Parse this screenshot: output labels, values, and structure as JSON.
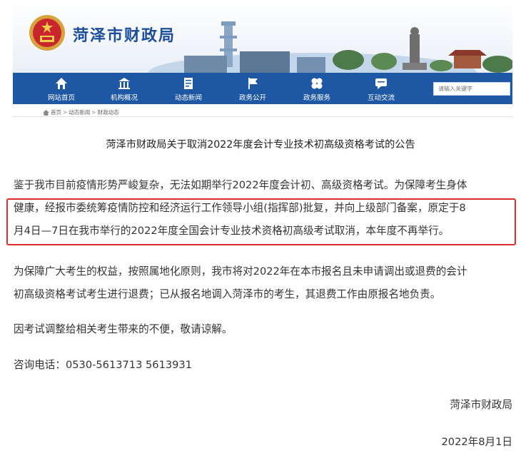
{
  "header": {
    "site_name": "菏泽市财政局",
    "search": {
      "placeholder": "请输入关键字"
    }
  },
  "nav": {
    "items": [
      {
        "label": "网站首页",
        "icon": "home-icon"
      },
      {
        "label": "机构概况",
        "icon": "building-icon"
      },
      {
        "label": "动态新闻",
        "icon": "document-icon"
      },
      {
        "label": "政务公开",
        "icon": "flag-icon"
      },
      {
        "label": "政务服务",
        "icon": "clover-icon"
      },
      {
        "label": "互动交流",
        "icon": "chat-icon"
      }
    ]
  },
  "breadcrumb": {
    "items": [
      "首页",
      "动态新闻",
      "财政动态"
    ],
    "separator": ">"
  },
  "article": {
    "title": "菏泽市财政局关于取消2022年度会计专业技术初高级资格考试的公告",
    "paragraph1": {
      "line1": "鉴于我市目前疫情形势严峻复杂，无法如期举行2022年度会计初、高级资格考试。为保障考生身体",
      "line2": "健康，经报市委统筹疫情防控和经济运行工作领导小组(指挥部)批复，并向上级部门备案，原定于8",
      "line3": "月4日—7日在我市举行的2022年度全国会计专业技术资格初高级考试取消，本年度不再举行。"
    },
    "paragraph2": {
      "line1": "为保障广大考生的权益，按照属地化原则，我市将对2022年在本市报名且未申请调出或退费的会计",
      "line2": "初高级资格考试考生进行退费；已从报名地调入菏泽市的考生，其退费工作由原报名地负责。"
    },
    "paragraph3": "因考试调整给相关考生带来的不便，敬请谅解。",
    "contact": "咨询电话：0530-5613713 5613931",
    "signature": "菏泽市财政局",
    "date": "2022年8月1日"
  },
  "colors": {
    "nav_bg": "#1e58a4",
    "site_name": "#1a4d9c",
    "highlight_border": "#e02b2b"
  }
}
